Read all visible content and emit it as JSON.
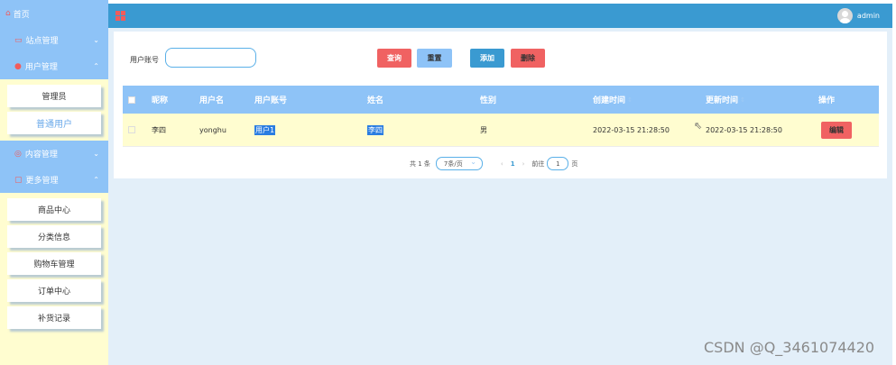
{
  "sidebar": {
    "home_label": "首页",
    "home_icon": "home-icon",
    "groups": [
      {
        "label": "站点管理",
        "icon": "monitor-icon"
      },
      {
        "label": "用户管理",
        "icon": "user-icon"
      },
      {
        "label": "内容管理",
        "icon": "circle-icon"
      },
      {
        "label": "更多管理",
        "icon": "grid-icon"
      }
    ],
    "user_sub": [
      "管理员",
      "普通用户"
    ],
    "more_sub": [
      "商品中心",
      "分类信息",
      "购物车管理",
      "订单中心",
      "补货记录"
    ]
  },
  "topbar": {
    "username": "admin"
  },
  "search": {
    "label": "用户账号",
    "value": ""
  },
  "buttons": {
    "query": "查询",
    "reset": "重置",
    "add": "添加",
    "delete": "删除",
    "edit": "编辑"
  },
  "table": {
    "headers": [
      "昵称",
      "用户名",
      "用户账号",
      "姓名",
      "性别",
      "创建时间",
      "更新时间",
      "操作"
    ],
    "rows": [
      {
        "nickname": "李四",
        "username": "yonghu",
        "account": "用户1",
        "name": "李四",
        "gender": "男",
        "created": "2022-03-15 21:28:50",
        "updated": "2022-03-15 21:28:50"
      }
    ]
  },
  "pagination": {
    "total": "共 1 条",
    "page_size": "7条/页",
    "current": "1",
    "goto_label": "前往",
    "goto_value": "1",
    "page_suffix": "页"
  },
  "watermark": "CSDN @Q_3461074420",
  "colors": {
    "sidebar_bg": "#fffdd0",
    "menu_bg": "#8ec3f7",
    "topbar_bg": "#3a9ad1",
    "danger": "#f06262"
  }
}
